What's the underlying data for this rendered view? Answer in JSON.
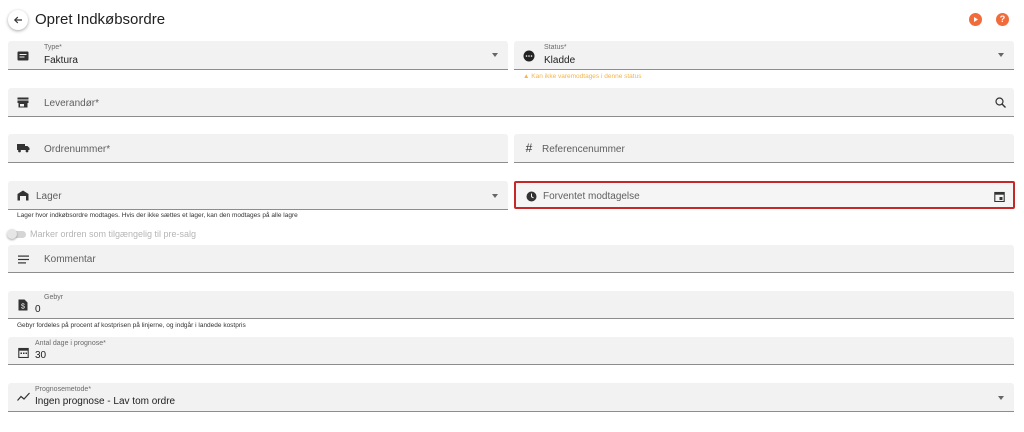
{
  "header": {
    "title": "Opret Indkøbsordre",
    "play_icon": "play-circle-icon",
    "help_icon": "help-circle-icon",
    "accent_color": "#f26b3a"
  },
  "form": {
    "type": {
      "label": "Type*",
      "value": "Faktura",
      "icon": "receipt-icon"
    },
    "status": {
      "label": "Status*",
      "value": "Kladde",
      "icon": "more-circle-icon",
      "warning": "Kan ikke varemodtages i denne status"
    },
    "supplier": {
      "placeholder": "Leverandør*",
      "icon": "store-icon",
      "trailing_icon": "search-icon"
    },
    "order_number": {
      "placeholder": "Ordrenummer*",
      "icon": "truck-icon"
    },
    "reference_number": {
      "placeholder": "Referencenummer",
      "icon": "hash-icon"
    },
    "warehouse": {
      "placeholder": "Lager",
      "icon": "warehouse-icon",
      "helper": "Lager hvor indkøbsordre modtages. Hvis der ikke sættes et lager, kan den modtages på alle lagre"
    },
    "expected_receipt": {
      "placeholder": "Forventet modtagelse",
      "icon": "clock-icon",
      "trailing_icon": "calendar-icon"
    },
    "presale_toggle": {
      "label": "Marker ordren som tilgængelig til pre-salg",
      "checked": false
    },
    "comment": {
      "placeholder": "Kommentar",
      "icon": "notes-icon"
    },
    "fee": {
      "label": "Gebyr",
      "value": "0",
      "icon": "dollar-doc-icon",
      "helper": "Gebyr fordeles på procent af kostprisen på linjerne, og indgår i landede kostpris"
    },
    "forecast_days": {
      "label": "Antal dage i prognose*",
      "value": "30",
      "icon": "calendar-icon"
    },
    "forecast_method": {
      "label": "Prognosemetode*",
      "value": "Ingen prognose - Lav tom ordre",
      "icon": "trend-icon"
    }
  }
}
